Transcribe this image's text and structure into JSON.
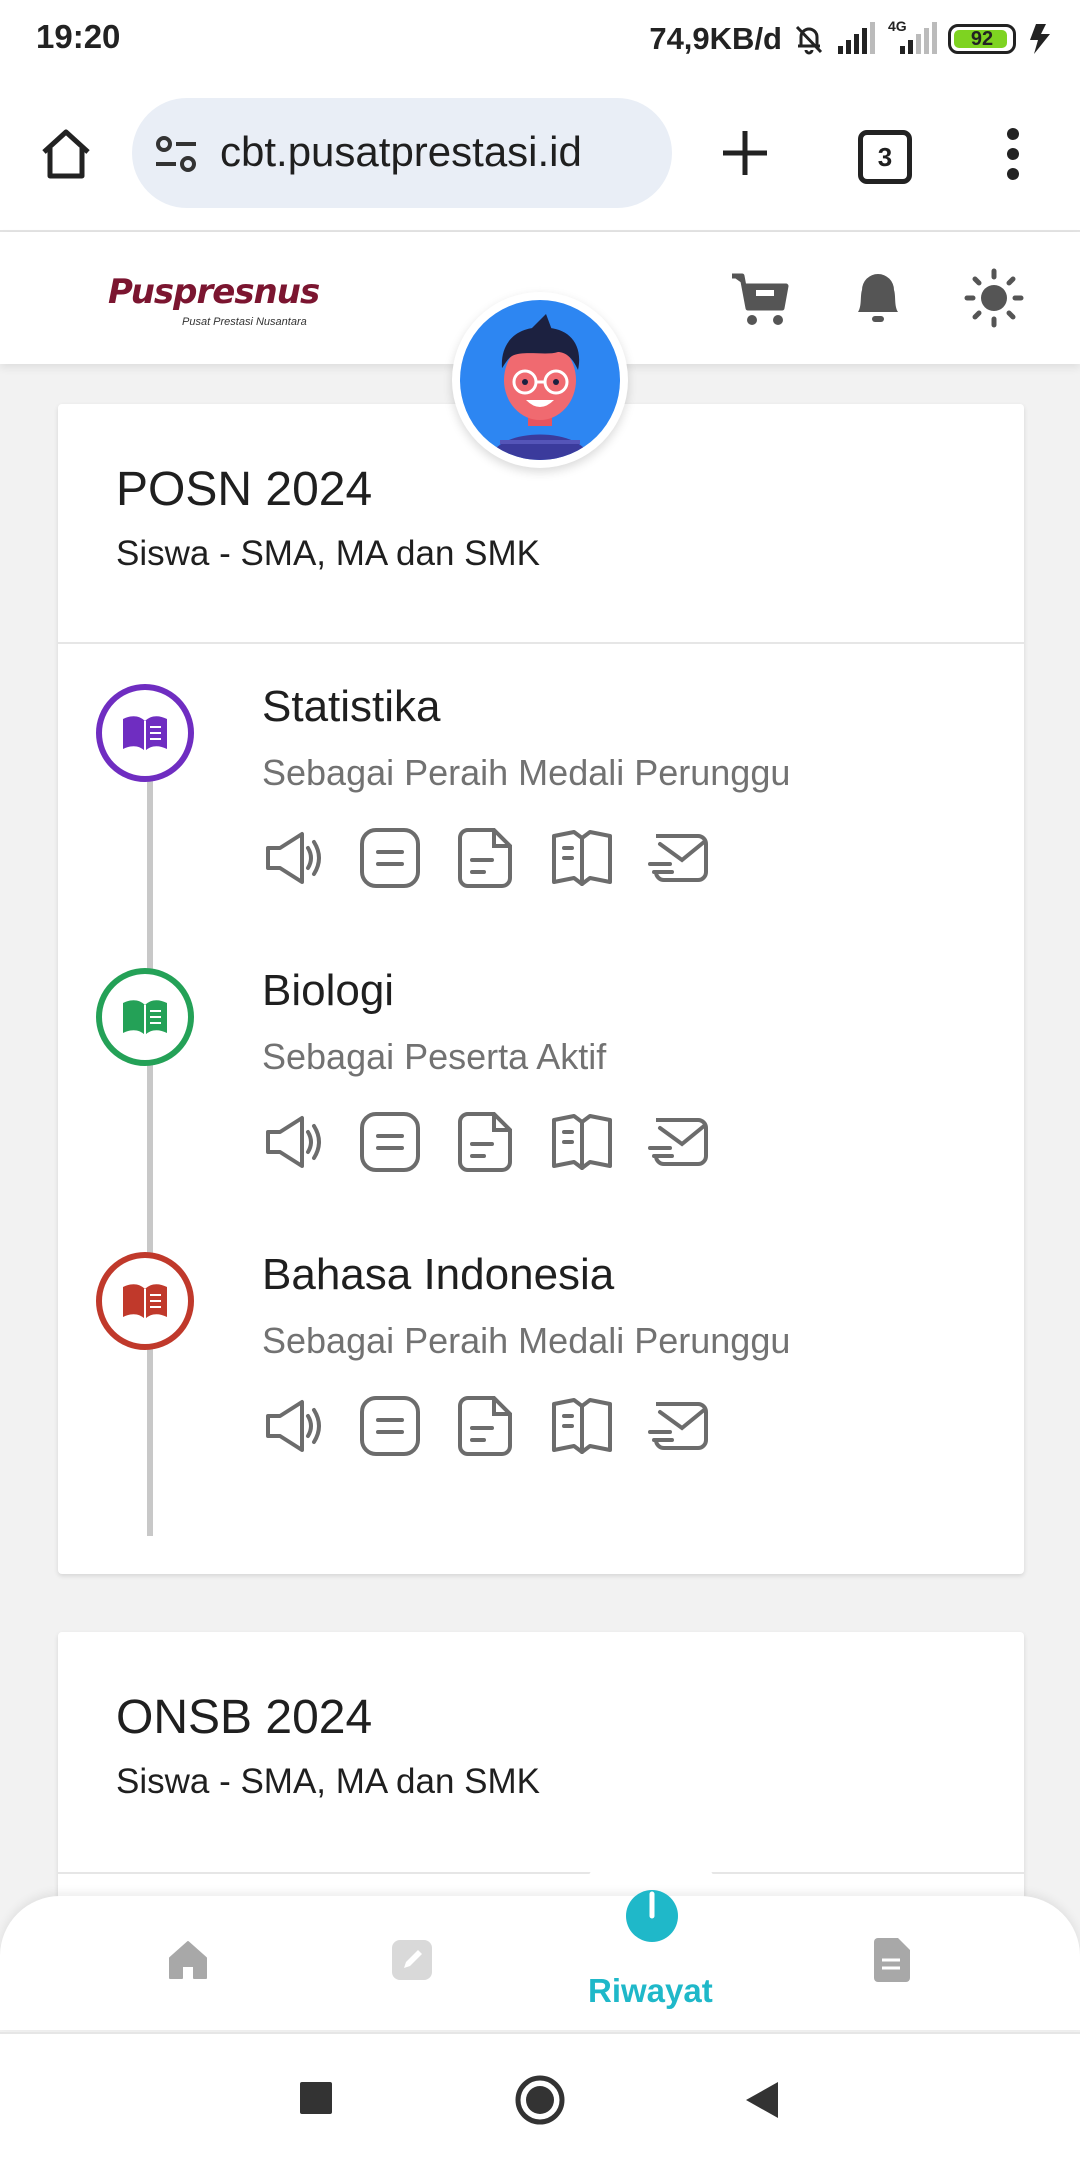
{
  "status_bar": {
    "time": "19:20",
    "network_speed": "74,9KB/d",
    "network_type": "4G",
    "battery_level": "92",
    "icons": [
      "mute-bell-icon",
      "signal-icon",
      "signal-4g-icon",
      "battery-icon",
      "charging-icon"
    ]
  },
  "browser": {
    "url": "cbt.pusatprestasi.id",
    "tab_count": "3",
    "icons": [
      "home-icon",
      "site-info-icon",
      "new-tab-icon",
      "tab-switcher-icon",
      "more-menu-icon"
    ]
  },
  "app_header": {
    "logo_title": "Puspresnus",
    "logo_subtitle": "Pusat Prestasi Nusantara",
    "icons": [
      "cart-icon",
      "bell-icon",
      "theme-sun-icon"
    ]
  },
  "cards": [
    {
      "title": "POSN 2024",
      "subtitle": "Siswa - SMA, MA dan SMK",
      "subjects": [
        {
          "name": "Statistika",
          "role": "Sebagai Peraih Medali Perunggu",
          "color": "#6f2dc1"
        },
        {
          "name": "Biologi",
          "role": "Sebagai Peserta Aktif",
          "color": "#24a157"
        },
        {
          "name": "Bahasa Indonesia",
          "role": "Sebagai Peraih Medali Perunggu",
          "color": "#c0392b"
        }
      ],
      "action_icons": [
        "speaker-icon",
        "menu-doc-icon",
        "file-icon",
        "book-icon",
        "mail-icon"
      ]
    },
    {
      "title": "ONSB 2024",
      "subtitle": "Siswa - SMA, MA dan SMK"
    }
  ],
  "bottom_nav": {
    "active_label": "Riwayat",
    "active_color": "#1fb8c9",
    "items": [
      "home-icon",
      "edit-icon",
      "history-icon",
      "document-icon"
    ]
  },
  "system_nav": [
    "recents-button",
    "home-button",
    "back-button"
  ]
}
